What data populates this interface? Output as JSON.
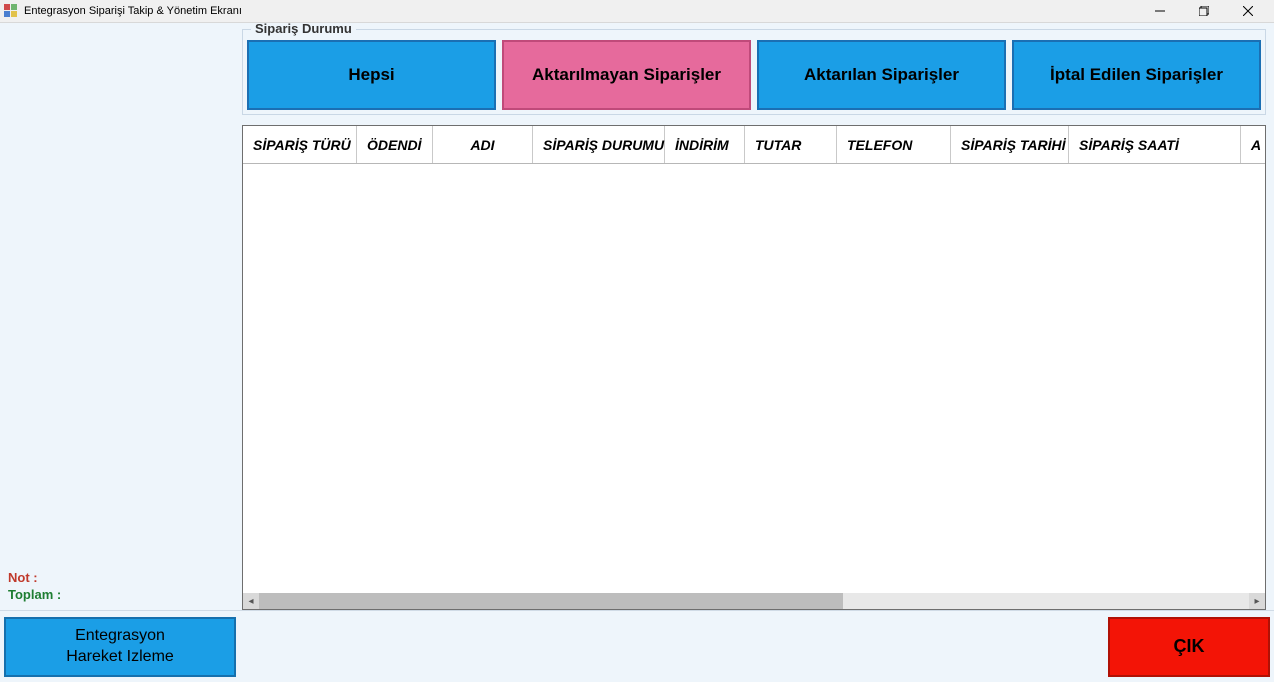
{
  "window": {
    "title": "Entegrasyon Siparişi Takip & Yönetim Ekranı"
  },
  "group": {
    "title": "Sipariş Durumu",
    "filters": {
      "all": "Hepsi",
      "not_transferred": "Aktarılmayan Siparişler",
      "transferred": "Aktarılan Siparişler",
      "cancelled": "İptal Edilen Siparişler"
    }
  },
  "grid": {
    "columns": {
      "c0": "SİPARİŞ TÜRÜ",
      "c1": "ÖDENDİ",
      "c2": "ADI",
      "c3": "SİPARİŞ DURUMU",
      "c4": "İNDİRİM",
      "c5": "TUTAR",
      "c6": "TELEFON",
      "c7": "SİPARİŞ TARİHİ",
      "c8": "SİPARİŞ SAATİ",
      "c9": "A"
    }
  },
  "info": {
    "note_label": "Not :",
    "total_label": "Toplam :"
  },
  "buttons": {
    "track": "Entegrasyon\nHareket Izleme",
    "exit": "ÇIK"
  }
}
